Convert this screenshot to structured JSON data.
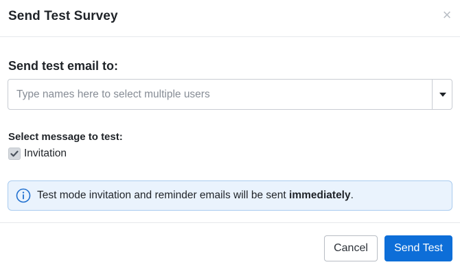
{
  "dialog": {
    "title": "Send Test Survey",
    "close_glyph": "×"
  },
  "recipients": {
    "heading": "Send test email to:",
    "placeholder": "Type names here to select multiple users",
    "value": ""
  },
  "message": {
    "heading": "Select message to test:",
    "options": [
      {
        "label": "Invitation",
        "checked": true
      }
    ]
  },
  "notice": {
    "text_before": "Test mode invitation and reminder emails will be sent ",
    "text_bold": "immediately",
    "text_after": ".",
    "icon": "info-circle-icon"
  },
  "footer": {
    "cancel_label": "Cancel",
    "send_label": "Send Test"
  },
  "colors": {
    "primary": "#0d6ed8",
    "info_bg": "#eaf3fd",
    "info_border": "#a9cbef",
    "checkbox_bg": "#d5d9de"
  }
}
